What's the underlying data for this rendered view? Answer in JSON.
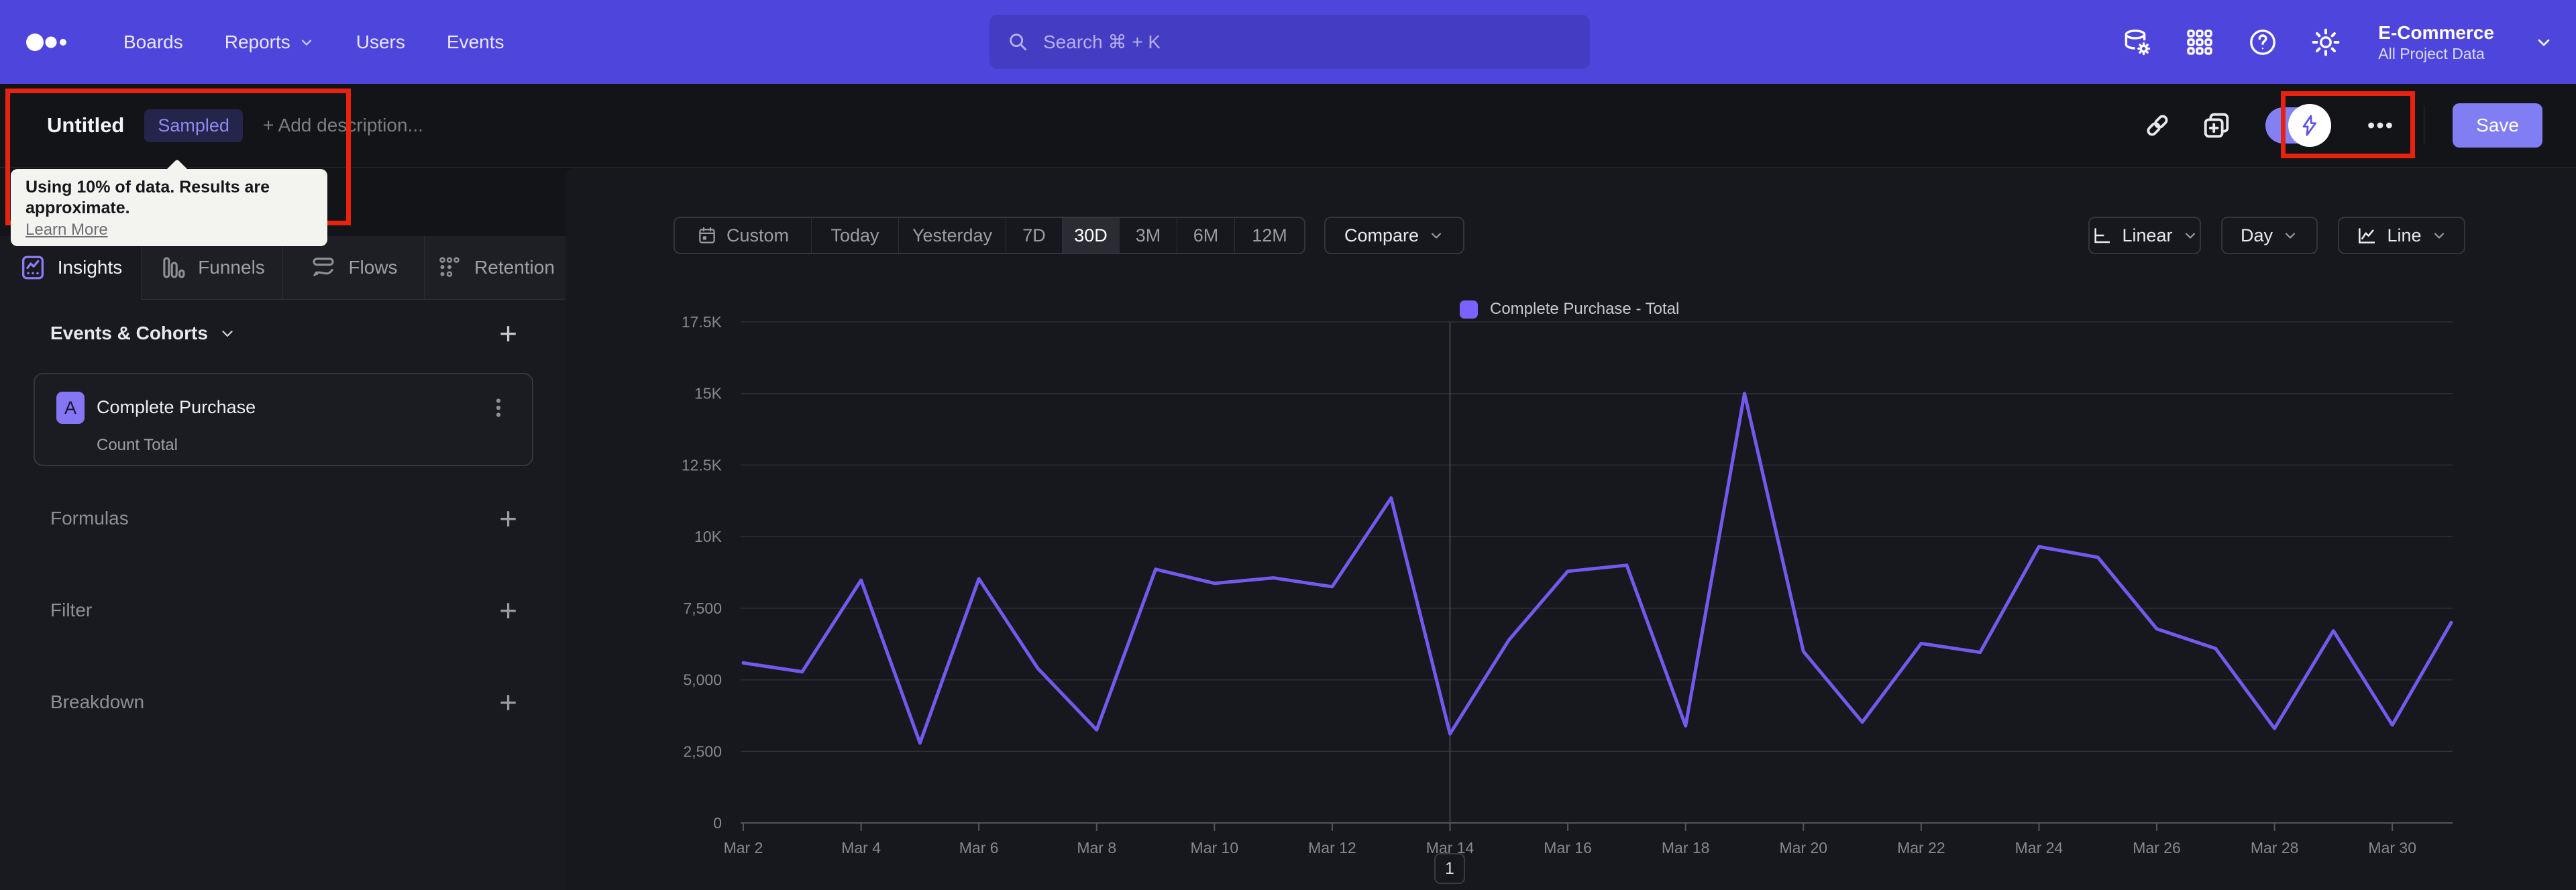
{
  "topnav": {
    "nav_items": [
      {
        "label": "Boards",
        "chevron": false
      },
      {
        "label": "Reports",
        "chevron": true
      },
      {
        "label": "Users",
        "chevron": false
      },
      {
        "label": "Events",
        "chevron": false
      }
    ],
    "search_placeholder": "Search  ⌘ + K",
    "project_name": "E-Commerce",
    "project_scope": "All Project Data"
  },
  "report_bar": {
    "title": "Untitled",
    "badge": "Sampled",
    "description_placeholder": "+ Add description...",
    "save_label": "Save"
  },
  "tooltip": {
    "text": "Using 10% of data. Results are approximate.",
    "link_label": "Learn More"
  },
  "sidebar": {
    "tabs": [
      {
        "label": "Insights",
        "icon": "insights",
        "active": true
      },
      {
        "label": "Funnels",
        "icon": "funnels",
        "active": false
      },
      {
        "label": "Flows",
        "icon": "flows",
        "active": false
      },
      {
        "label": "Retention",
        "icon": "retention",
        "active": false
      }
    ],
    "events_header": "Events & Cohorts",
    "event": {
      "letter": "A",
      "name": "Complete Purchase",
      "metric": "Count Total"
    },
    "formulas_label": "Formulas",
    "filter_label": "Filter",
    "breakdown_label": "Breakdown"
  },
  "controls": {
    "ranges": [
      "Custom",
      "Today",
      "Yesterday",
      "7D",
      "30D",
      "3M",
      "6M",
      "12M"
    ],
    "active_range": "30D",
    "compare_label": "Compare",
    "scale_label": "Linear",
    "interval_label": "Day",
    "chart_type_label": "Line"
  },
  "chart_data": {
    "type": "line",
    "title": "",
    "x": [
      "Mar 2",
      "Mar 3",
      "Mar 4",
      "Mar 5",
      "Mar 6",
      "Mar 7",
      "Mar 8",
      "Mar 9",
      "Mar 10",
      "Mar 11",
      "Mar 12",
      "Mar 13",
      "Mar 14",
      "Mar 15",
      "Mar 16",
      "Mar 17",
      "Mar 18",
      "Mar 19",
      "Mar 20",
      "Mar 21",
      "Mar 22",
      "Mar 23",
      "Mar 24",
      "Mar 25",
      "Mar 26",
      "Mar 27",
      "Mar 28",
      "Mar 29",
      "Mar 30",
      "Mar 31"
    ],
    "series": [
      {
        "name": "Complete Purchase - Total",
        "color": "#7459ef",
        "values": [
          5590,
          5280,
          8480,
          2790,
          8530,
          5400,
          3250,
          8860,
          8370,
          8560,
          8250,
          11350,
          3110,
          6390,
          8790,
          9000,
          3390,
          15000,
          5990,
          3520,
          6270,
          5960,
          9650,
          9280,
          6780,
          6090,
          3300,
          6710,
          3420,
          7000
        ]
      }
    ],
    "ylim": [
      0,
      17500
    ],
    "y_ticks": [
      "0",
      "2,500",
      "5,000",
      "7,500",
      "10K",
      "12.5K",
      "15K",
      "17.5K"
    ],
    "x_tick_every": 2,
    "vertical_marker_x": "Mar 14",
    "grid": true,
    "legend_position": "top-center"
  },
  "pagination": {
    "page": "1"
  },
  "colors": {
    "nav_purple": "#4e46dc",
    "accent_purple": "#817ef3",
    "line_purple": "#7459ef",
    "annotation_red": "#e72310",
    "page_bg": "#131418",
    "panel_bg": "#191a20",
    "main_bg": "#17181d"
  }
}
